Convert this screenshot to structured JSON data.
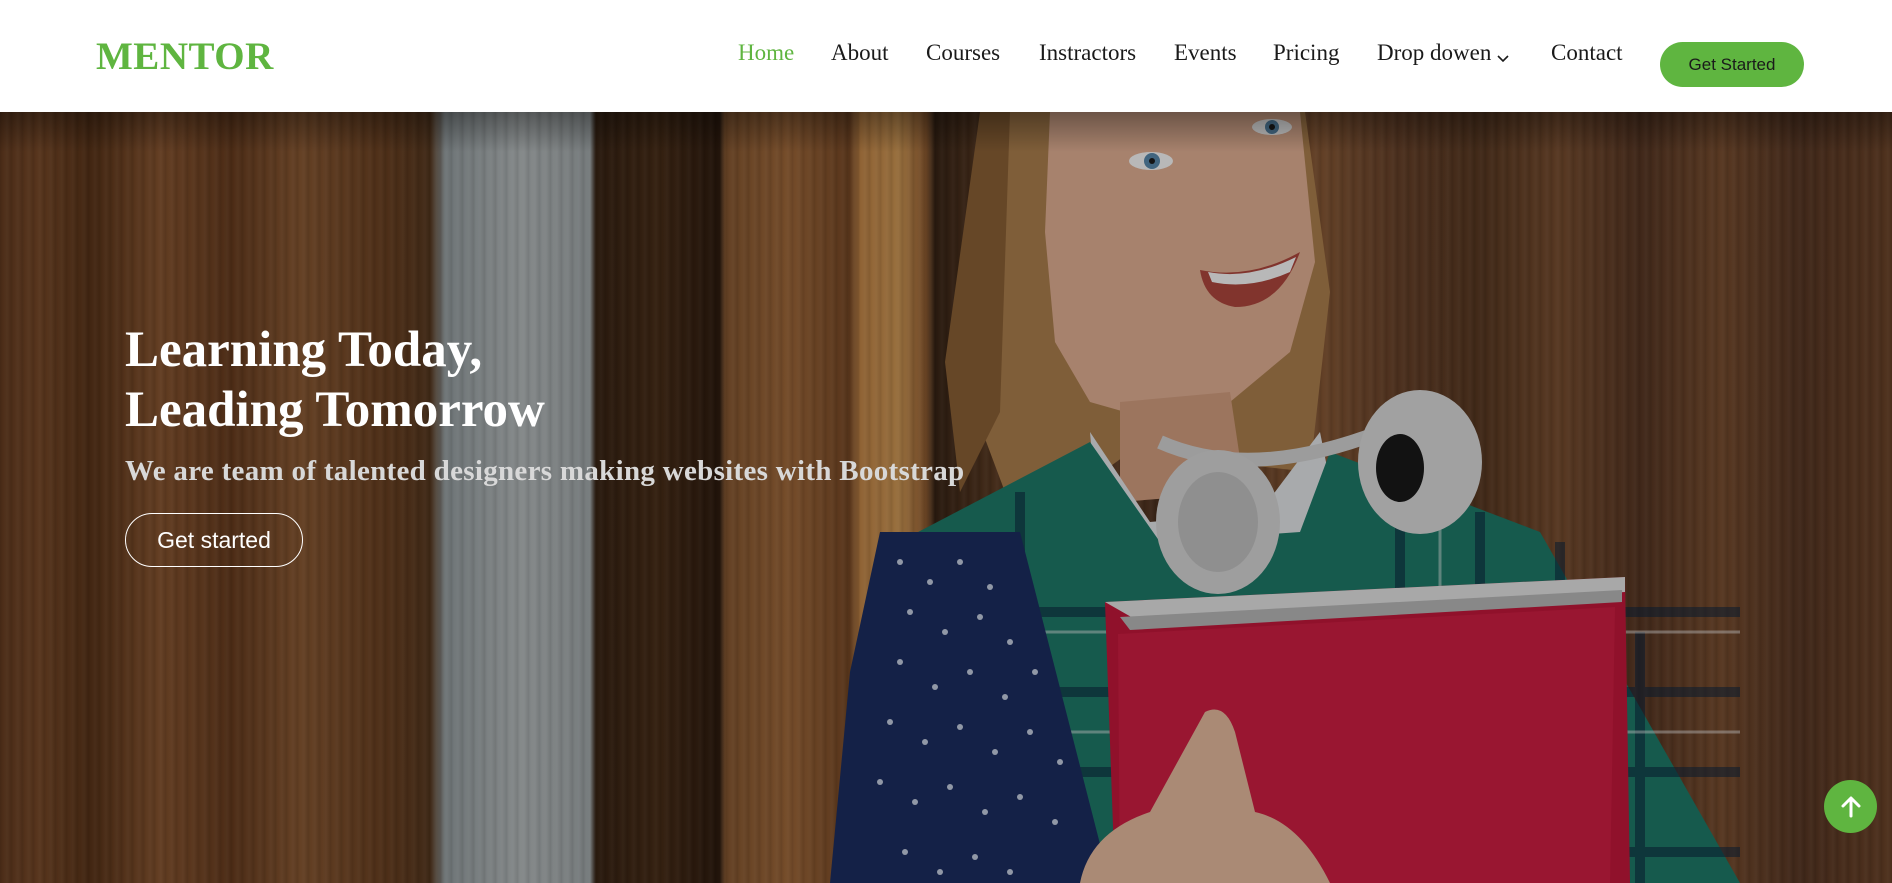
{
  "brand": {
    "logo": "MENTOR"
  },
  "nav": {
    "items": [
      {
        "label": "Home",
        "active": true
      },
      {
        "label": "About"
      },
      {
        "label": "Courses"
      },
      {
        "label": "Instractors"
      },
      {
        "label": "Events"
      },
      {
        "label": "Pricing"
      },
      {
        "label": "Drop dowen",
        "has_dropdown": true,
        "icon": "chevron-down-icon"
      },
      {
        "label": "Contact"
      }
    ],
    "cta_label": "Get Started"
  },
  "hero": {
    "title_line1": "Learning Today,",
    "title_line2": "Leading Tomorrow",
    "subtitle": "We are team of talented designers making websites with Bootstrap",
    "button_label": "Get started"
  },
  "back_to_top": {
    "icon": "arrow-up-icon"
  },
  "colors": {
    "accent": "#5fb540",
    "text_dark": "#1a1a1a",
    "white": "#ffffff"
  }
}
